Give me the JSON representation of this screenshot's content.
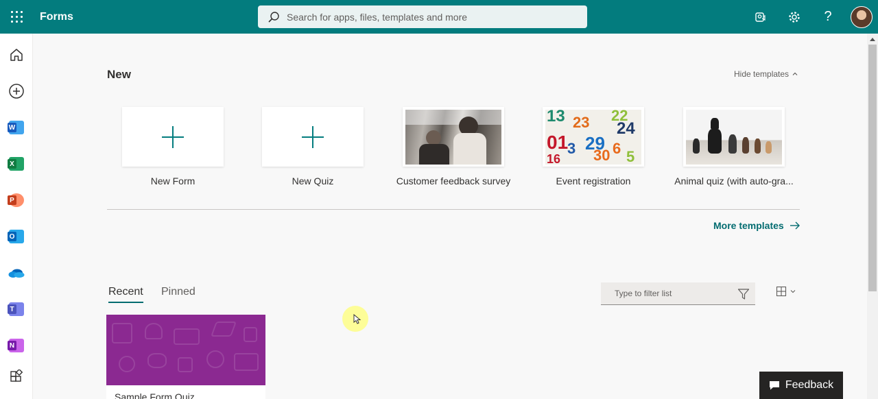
{
  "header": {
    "app_name": "Forms",
    "search_placeholder": "Search for apps, files, templates and more",
    "brand_color": "#037c7e"
  },
  "rail": {
    "items": [
      {
        "name": "home",
        "icon": "home-icon"
      },
      {
        "name": "create",
        "icon": "add-circle-icon"
      },
      {
        "name": "word",
        "icon": "word-icon",
        "letter": "W"
      },
      {
        "name": "excel",
        "icon": "excel-icon",
        "letter": "X"
      },
      {
        "name": "powerpoint",
        "icon": "powerpoint-icon",
        "letter": "P"
      },
      {
        "name": "outlook",
        "icon": "outlook-icon",
        "letter": "O"
      },
      {
        "name": "onedrive",
        "icon": "onedrive-icon"
      },
      {
        "name": "teams",
        "icon": "teams-icon",
        "letter": "T"
      },
      {
        "name": "onenote",
        "icon": "onenote-icon",
        "letter": "N"
      },
      {
        "name": "all-apps",
        "icon": "all-apps-icon"
      }
    ]
  },
  "new_section": {
    "heading": "New",
    "hide_templates_label": "Hide templates",
    "cards": [
      {
        "label": "New Form"
      },
      {
        "label": "New Quiz"
      },
      {
        "label": "Customer feedback survey"
      },
      {
        "label": "Event registration"
      },
      {
        "label": "Animal quiz (with auto-gra..."
      }
    ],
    "more_templates_label": "More templates"
  },
  "list_section": {
    "tabs": [
      {
        "label": "Recent",
        "selected": true
      },
      {
        "label": "Pinned",
        "selected": false
      }
    ],
    "filter_placeholder": "Type to filter list",
    "forms": [
      {
        "title": "Sample Form Quiz",
        "banner_color": "#8b2991"
      }
    ]
  },
  "feedback_label": "Feedback"
}
